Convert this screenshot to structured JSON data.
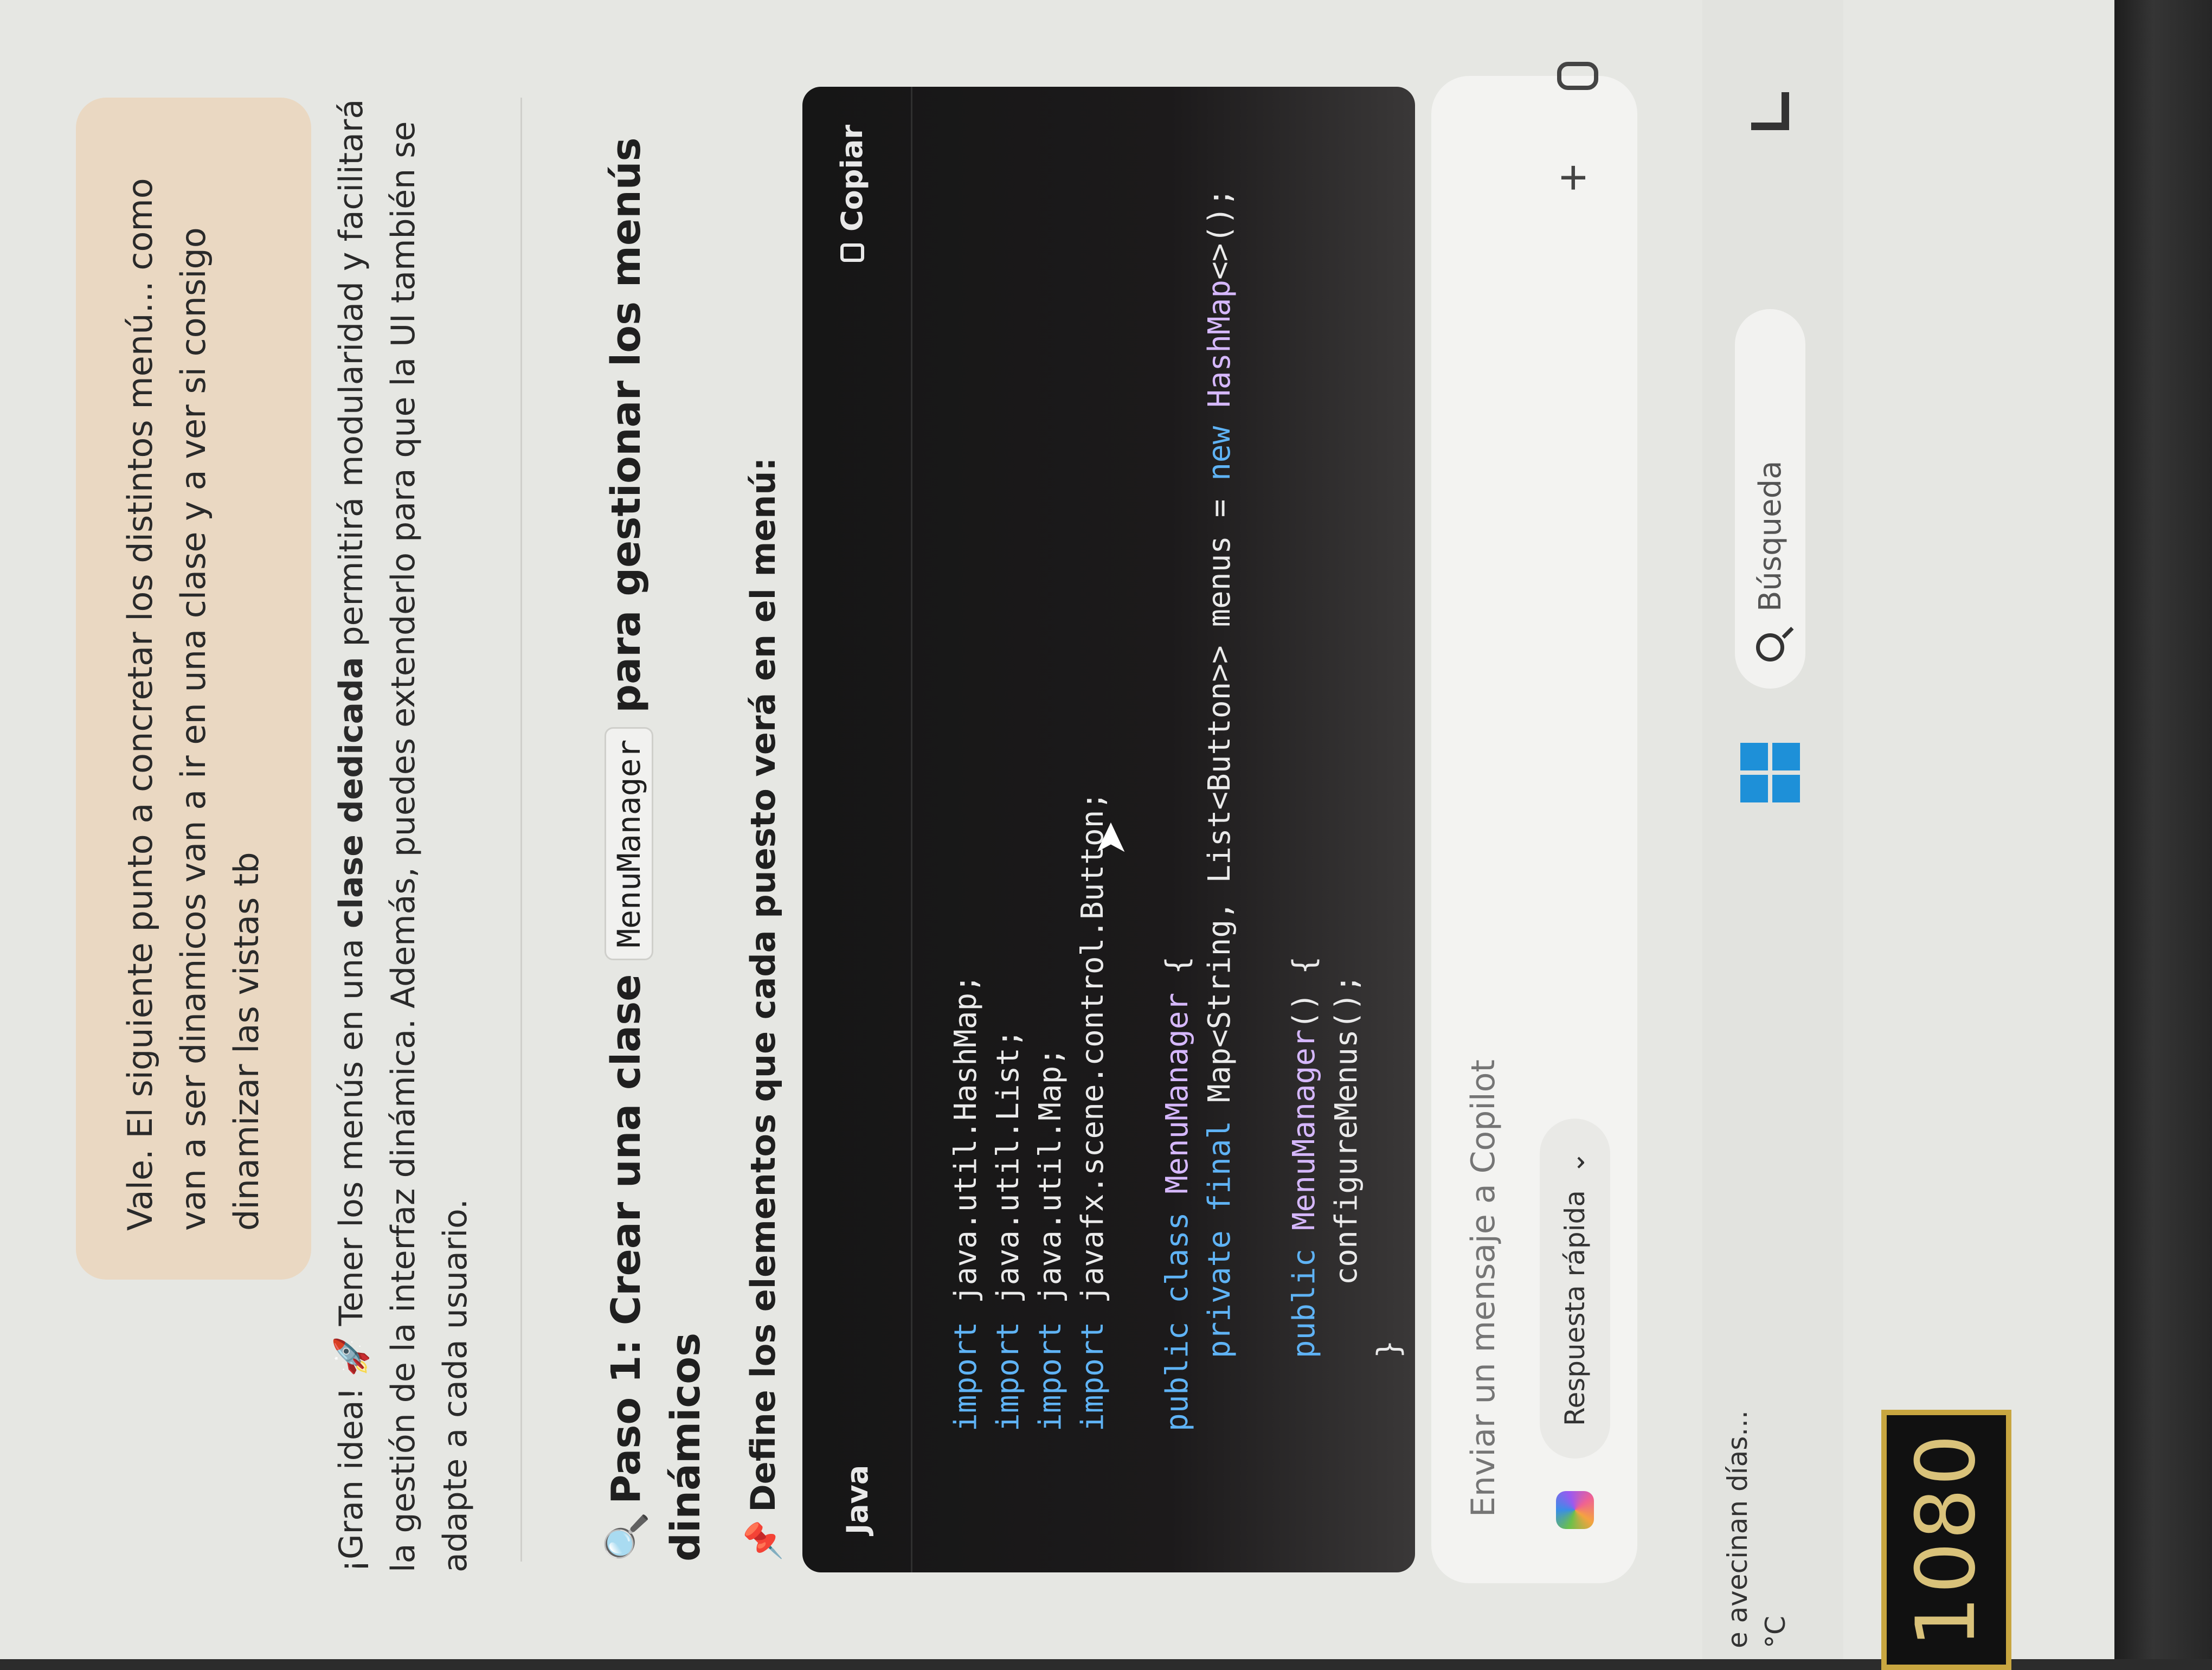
{
  "chat": {
    "user_message": "Vale. El siguiente punto a concretar los distintos menú... como van a ser dinamicos van a ir en una clase y a ver si consigo dinamizar las vistas tb",
    "reply_intro_a": "¡Gran idea! ",
    "reply_emoji": "🚀",
    "reply_intro_b": " Tener los menús en una ",
    "reply_bold": "clase dedicada",
    "reply_intro_c": " permitirá modularidad y facilitará la gestión de la interfaz dinámica. Además, puedes extenderlo para que la UI también se adapte a cada usuario.",
    "step_icon": "🔍",
    "step_title_a": "Paso 1: Crear una clase ",
    "step_code": "MenuManager",
    "step_title_b": " para gestionar los menús dinámicos",
    "bullet_icon": "📌",
    "bullet_text": "Define los elementos que cada puesto verá en el menú:"
  },
  "code_block": {
    "language": "Java",
    "copy_label": "Copiar",
    "lines": [
      "import java.util.HashMap;",
      "import java.util.List;",
      "import java.util.Map;",
      "import javafx.scene.control.Button;",
      "",
      "public class MenuManager {",
      "    private final Map<String, List<Button>> menus = new HashMap<>();",
      "",
      "    public MenuManager() {",
      "        configureMenus();",
      "    }"
    ]
  },
  "composer": {
    "placeholder": "Enviar un mensaje a Copilot",
    "quick_reply_label": "Respuesta rápida",
    "plus_label": "+"
  },
  "taskbar": {
    "weather_line1": "e avecinan días...",
    "weather_line2": "°C",
    "search_label": "Búsqueda"
  },
  "device": {
    "sticker_label": "1080"
  },
  "colors": {
    "accent_windows": "#1e90d8",
    "bubble_user": "#ead8c2",
    "code_bg": "#161616",
    "keyword": "#5fb3f5"
  },
  "icons": [
    "copy-icon",
    "copilot-icon",
    "chevron-down-icon",
    "plus-icon",
    "mic-icon",
    "windows-start-icon",
    "search-icon",
    "tray-icon"
  ]
}
